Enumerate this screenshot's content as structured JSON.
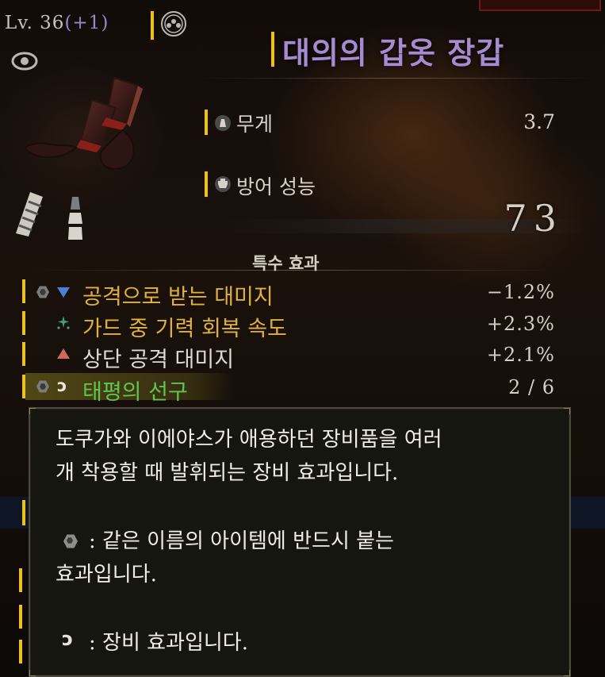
{
  "header": {
    "level_text": "Lv. 36",
    "level_bonus": "(+1)",
    "item_name": "대의의 갑옷 장갑"
  },
  "stats": {
    "weight_label": "무게",
    "weight_value": "3.7",
    "defense_label": "방어 성능",
    "defense_value": "73"
  },
  "special_effects": {
    "header": "특수 효과",
    "rows": [
      {
        "label": "공격으로 받는 대미지",
        "value": "−1.2%"
      },
      {
        "label": "가드 중 기력 회복 속도",
        "value": "+2.3%"
      },
      {
        "label": "상단 공격 대미지",
        "value": "+2.1%"
      },
      {
        "label": "태평의 선구",
        "value": "2 / 6"
      }
    ]
  },
  "tooltip": {
    "line1": "도쿠가와 이에야스가 애용하던 장비품을 여러",
    "line2": "개 착용할 때 발휘되는 장비 효과입니다.",
    "line3": ": 같은 이름의 아이템에 반드시 붙는",
    "line4": "효과입니다.",
    "line5": ": 장비 효과입니다."
  },
  "icons": [
    "clan-crest-icon",
    "eye-icon",
    "gauntlet-icon",
    "armor-piece-icon",
    "weight-icon",
    "defense-icon",
    "hexagon-icon",
    "arrow-down-icon",
    "sparkle-icon",
    "arrow-up-icon",
    "set-link-icon"
  ],
  "colors": {
    "accent_bar": "#e9c21c",
    "item_name": "#a78bd0",
    "effect_gold": "#e0b23c",
    "effect_green": "#5fc64e",
    "decrease_blue": "#4d7fd6",
    "increase_red": "#c96a5c"
  }
}
